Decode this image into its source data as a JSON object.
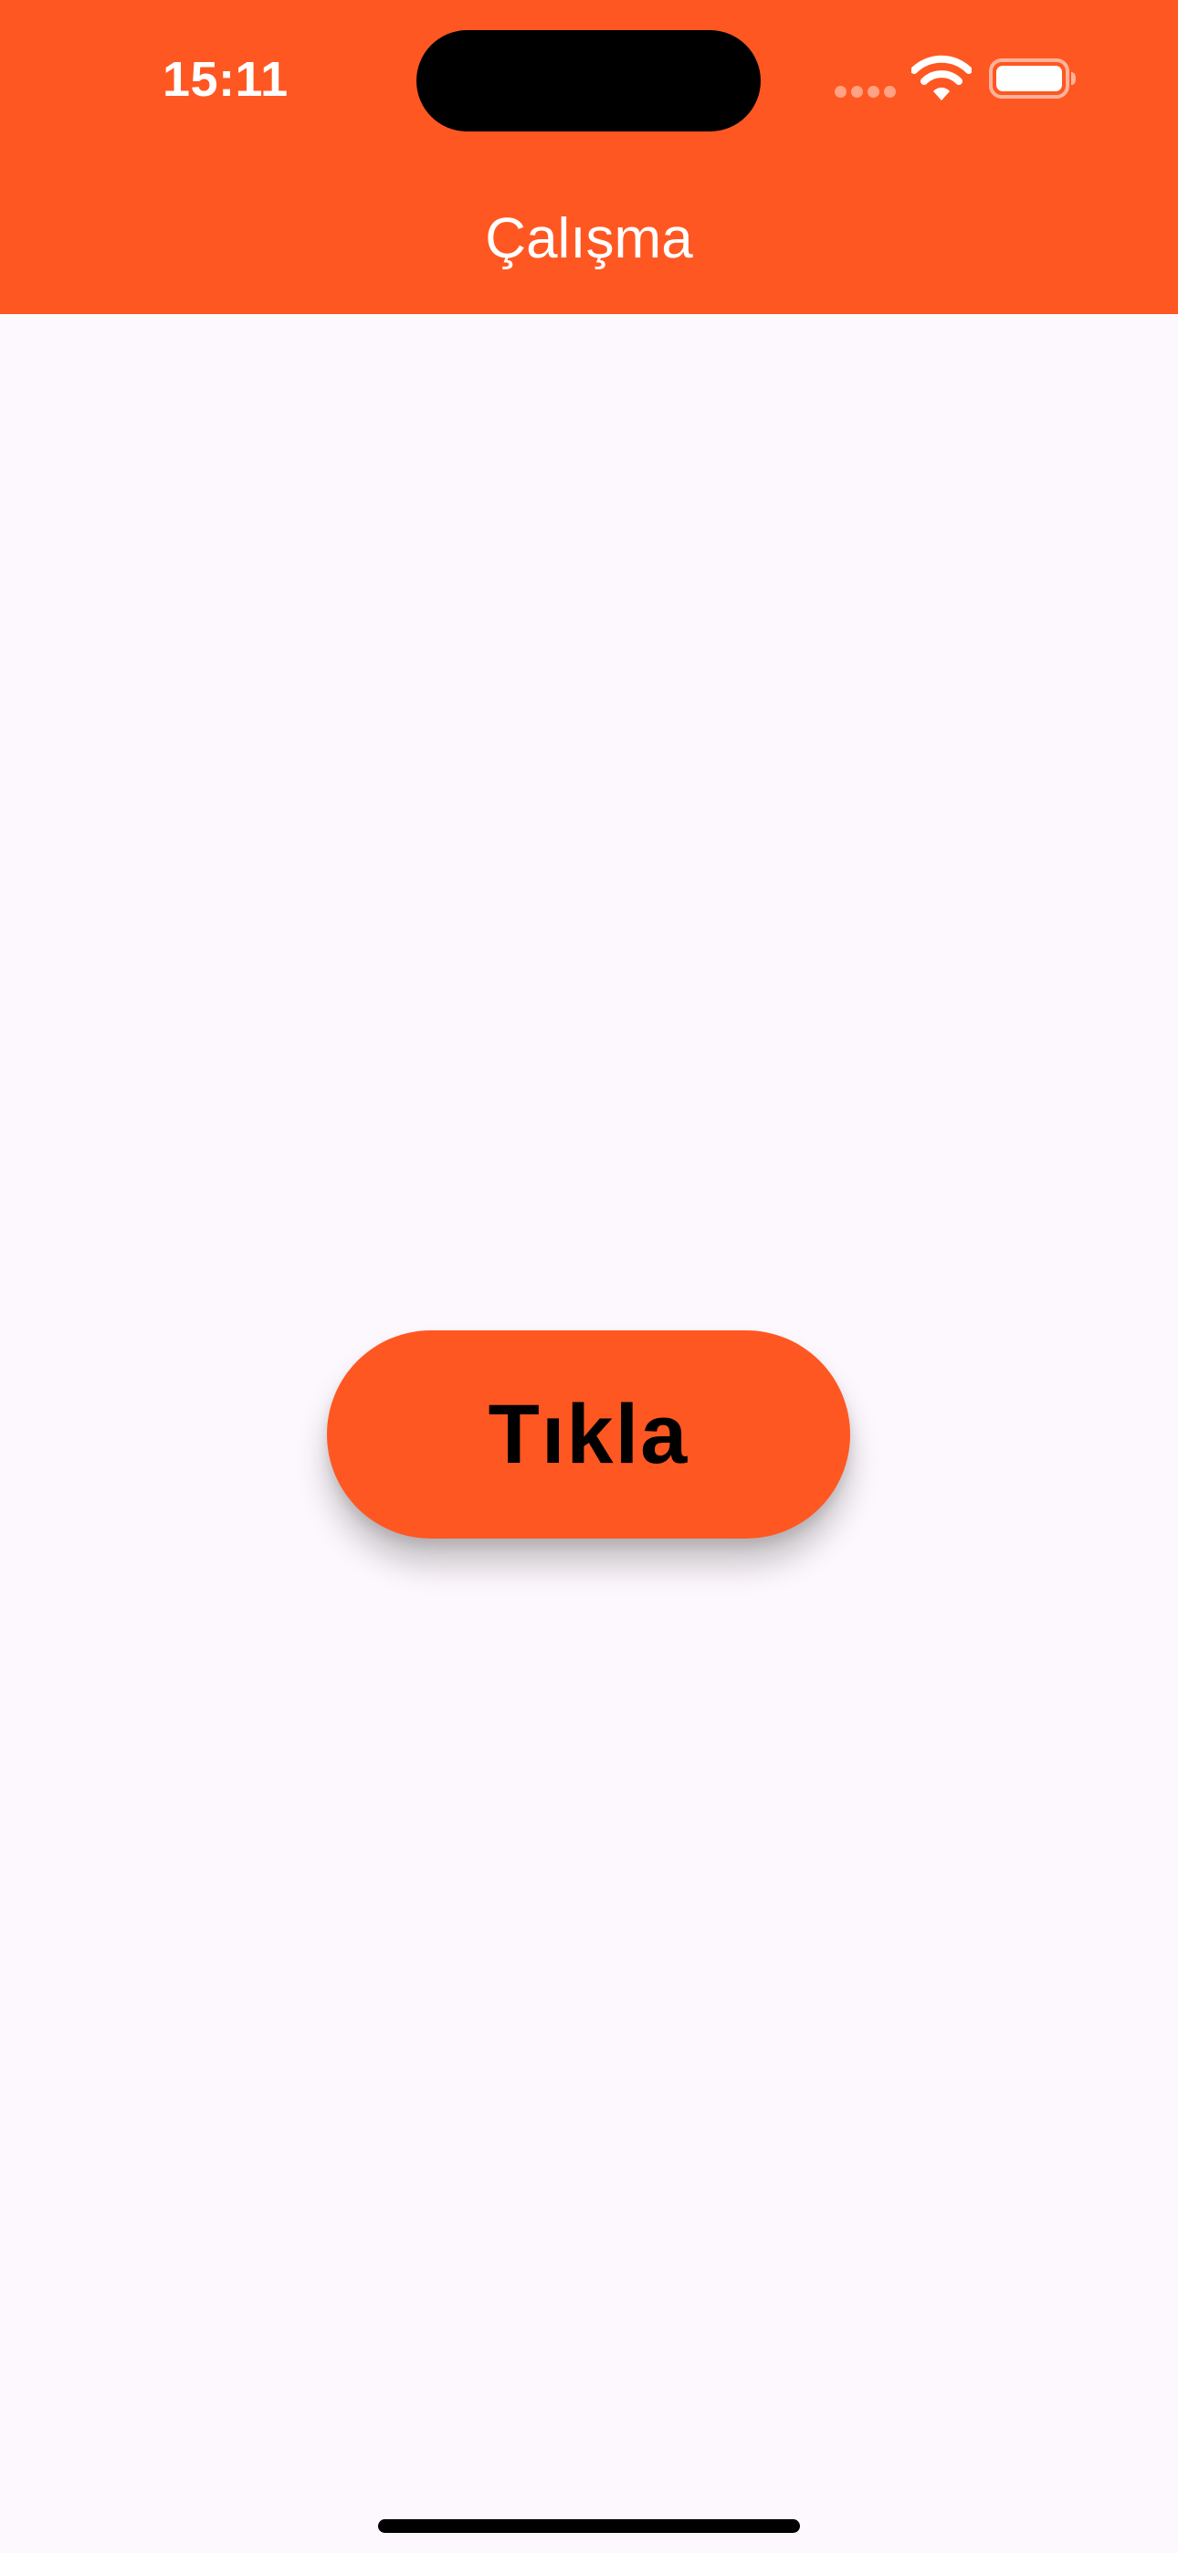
{
  "status_bar": {
    "time": "15:11",
    "icons": [
      "signal-icon",
      "wifi-icon",
      "battery-icon"
    ]
  },
  "app_bar": {
    "title": "Çalışma",
    "background_color": "#FF5722",
    "title_color": "#FFFFFF"
  },
  "main": {
    "button_label": "Tıkla",
    "button_color": "#FF5722",
    "background_color": "#FDF8FD"
  }
}
